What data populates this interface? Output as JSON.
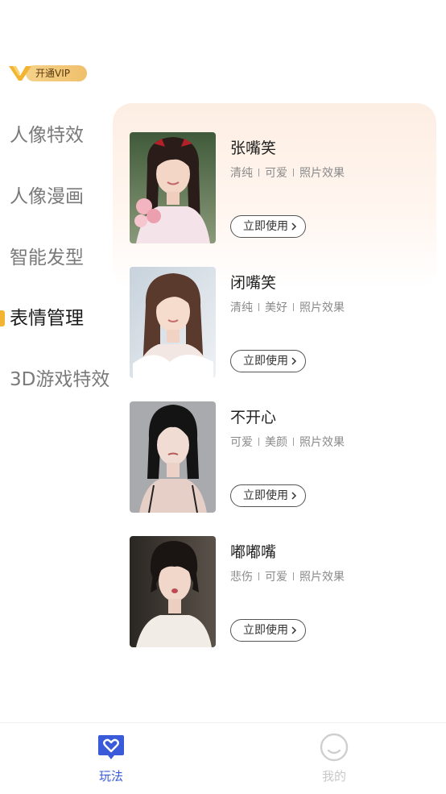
{
  "vip": {
    "label": "开通VIP"
  },
  "sidebar": {
    "items": [
      {
        "label": "人像特效",
        "active": false
      },
      {
        "label": "人像漫画",
        "active": false
      },
      {
        "label": "智能发型",
        "active": false
      },
      {
        "label": "表情管理",
        "active": true
      },
      {
        "label": "3D游戏特效",
        "active": false
      }
    ]
  },
  "cards": [
    {
      "title": "张嘴笑",
      "tags": [
        "清纯",
        "可爱",
        "照片效果"
      ],
      "button": "立即使用"
    },
    {
      "title": "闭嘴笑",
      "tags": [
        "清纯",
        "美好",
        "照片效果"
      ],
      "button": "立即使用"
    },
    {
      "title": "不开心",
      "tags": [
        "可爱",
        "美颜",
        "照片效果"
      ],
      "button": "立即使用"
    },
    {
      "title": "嘟嘟嘴",
      "tags": [
        "悲伤",
        "可爱",
        "照片效果"
      ],
      "button": "立即使用"
    }
  ],
  "tabbar": {
    "tabs": [
      {
        "label": "玩法",
        "icon": "heart-chat-icon",
        "active": true,
        "color": "#3a5bd9"
      },
      {
        "label": "我的",
        "icon": "smile-face-icon",
        "active": false,
        "color": "#c8c8c8"
      }
    ]
  },
  "colors": {
    "accent": "#f3b431",
    "active_tab": "#3a5bd9",
    "vip_gold": "#efc06b"
  }
}
